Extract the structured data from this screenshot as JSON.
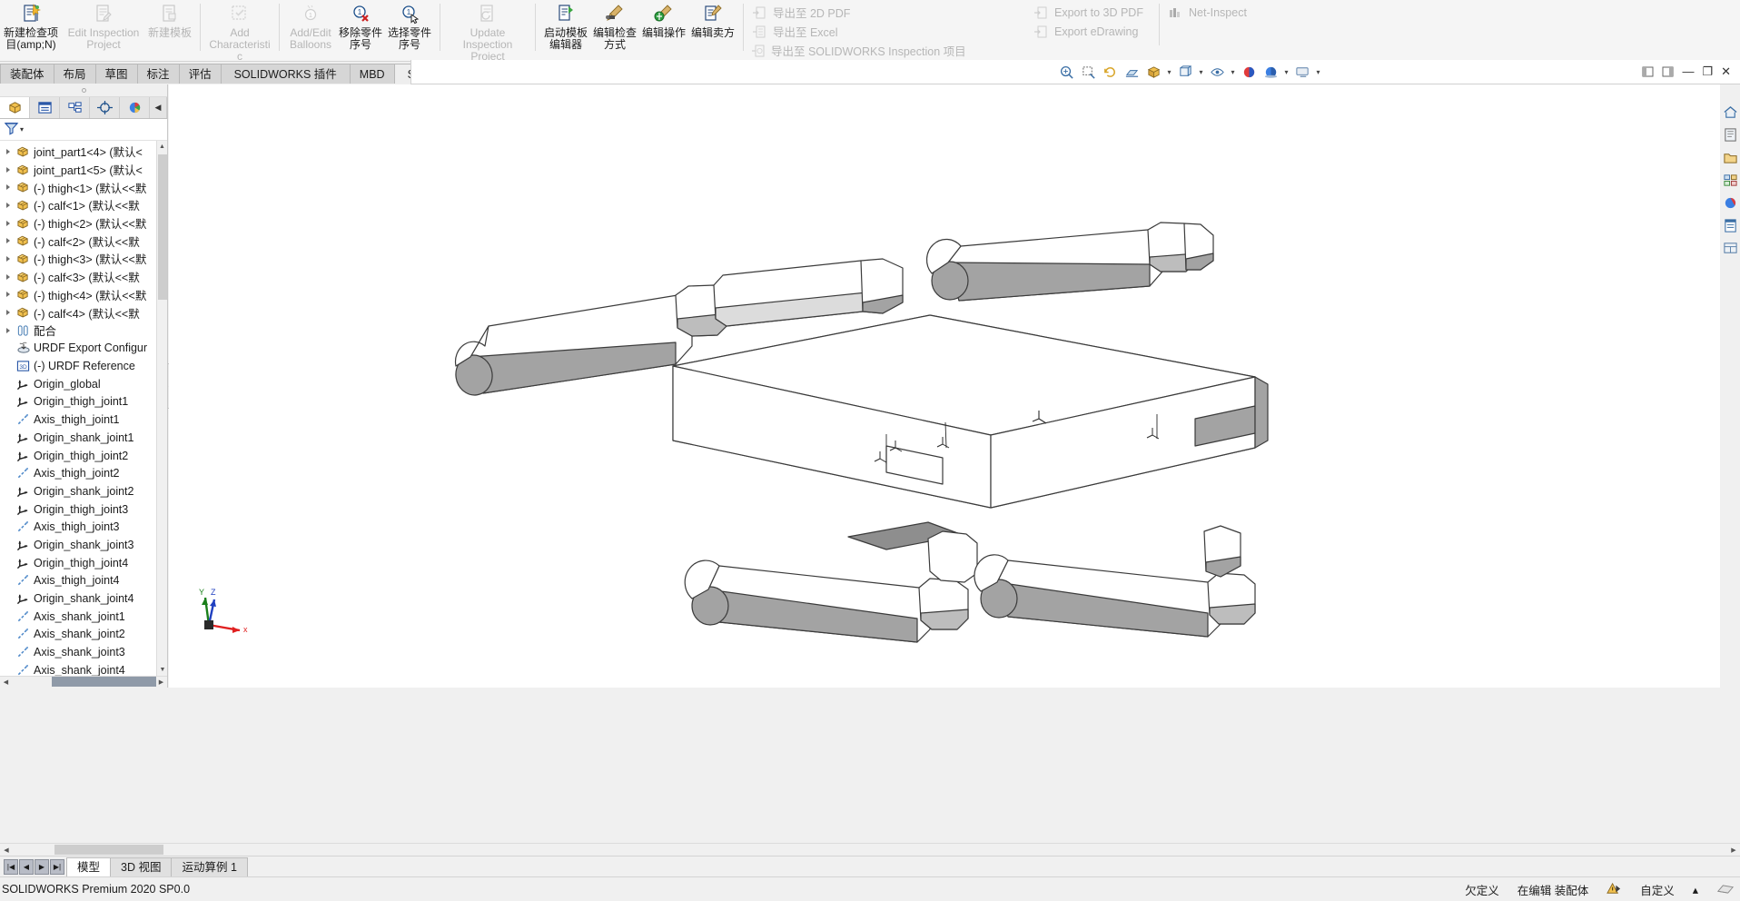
{
  "app": {
    "product": "SOLIDWORKS Premium 2020 SP0.0"
  },
  "ribbon": {
    "groups": [
      {
        "buttons": [
          {
            "name": "new-inspection-item",
            "label": "新建检查项目(amp;N)",
            "icon": "new-inspection-icon",
            "enabled": true
          },
          {
            "name": "edit-inspection-project",
            "label": "Edit Inspection Project",
            "icon": "edit-inspection-icon",
            "enabled": false
          },
          {
            "name": "new-template",
            "label": "新建模板",
            "icon": "new-template-icon",
            "enabled": false
          }
        ]
      },
      {
        "buttons": [
          {
            "name": "add-characteristic",
            "label": "Add Characteristic",
            "icon": "add-characteristic-icon",
            "enabled": false
          }
        ]
      },
      {
        "buttons": [
          {
            "name": "add-edit-balloons",
            "label": "Add/Edit Balloons",
            "icon": "balloon-icon",
            "enabled": false
          },
          {
            "name": "remove-balloon",
            "label": "移除零件序号",
            "icon": "remove-balloon-icon",
            "enabled": true
          },
          {
            "name": "select-balloon",
            "label": "选择零件序号",
            "icon": "select-balloon-icon",
            "enabled": true
          }
        ]
      },
      {
        "buttons": [
          {
            "name": "update-inspection-project",
            "label": "Update Inspection Project",
            "icon": "update-inspection-icon",
            "enabled": false
          }
        ]
      },
      {
        "buttons": [
          {
            "name": "launch-template-editor",
            "label": "启动模板编辑器",
            "icon": "template-editor-icon",
            "enabled": true
          },
          {
            "name": "edit-inspection-method",
            "label": "编辑检查方式",
            "icon": "edit-method-icon",
            "enabled": true
          },
          {
            "name": "edit-operation",
            "label": "编辑操作",
            "icon": "edit-operation-icon",
            "enabled": true
          },
          {
            "name": "edit-vendor",
            "label": "编辑卖方",
            "icon": "edit-vendor-icon",
            "enabled": true
          }
        ]
      }
    ],
    "export_list_1": [
      {
        "name": "export-2d-pdf",
        "label": "导出至 2D PDF",
        "icon": "export-icon"
      },
      {
        "name": "export-excel",
        "label": "导出至 Excel",
        "icon": "export-excel-icon"
      },
      {
        "name": "export-sw-inspection",
        "label": "导出至 SOLIDWORKS Inspection 项目",
        "icon": "export-sw-icon"
      }
    ],
    "export_list_2": [
      {
        "name": "export-3d-pdf",
        "label": "Export to 3D PDF",
        "icon": "export-icon"
      },
      {
        "name": "export-edrawing",
        "label": "Export eDrawing",
        "icon": "export-icon"
      }
    ],
    "net_inspect": [
      {
        "name": "net-inspect",
        "label": "Net-Inspect",
        "icon": "net-inspect-icon"
      }
    ]
  },
  "tabs": [
    {
      "name": "tab-assembly",
      "label": "装配体",
      "active": false
    },
    {
      "name": "tab-layout",
      "label": "布局",
      "active": false
    },
    {
      "name": "tab-sketch",
      "label": "草图",
      "active": false
    },
    {
      "name": "tab-annotation",
      "label": "标注",
      "active": false
    },
    {
      "name": "tab-evaluate",
      "label": "评估",
      "active": false
    },
    {
      "name": "tab-sw-addins",
      "label": "SOLIDWORKS 插件",
      "active": false
    },
    {
      "name": "tab-mbd",
      "label": "MBD",
      "active": false
    },
    {
      "name": "tab-sw-inspection",
      "label": "SOLIDWORKS Inspection",
      "active": true
    }
  ],
  "panel": {
    "tabs": [
      {
        "name": "feature-manager-tab",
        "icon": "feature-tree-icon",
        "active": true
      },
      {
        "name": "property-manager-tab",
        "icon": "property-manager-icon",
        "active": false
      },
      {
        "name": "configuration-manager-tab",
        "icon": "configuration-icon",
        "active": false
      },
      {
        "name": "dimxpert-manager-tab",
        "icon": "dimxpert-icon",
        "active": false
      },
      {
        "name": "display-manager-tab",
        "icon": "display-manager-icon",
        "active": false
      },
      {
        "name": "panel-tabs-more",
        "icon": "chevron-right-icon",
        "active": false
      }
    ],
    "filter_placeholder": ""
  },
  "tree": [
    {
      "name": "joint_part1-4",
      "label": "joint_part1<4> (默认<",
      "icon": "part-icon",
      "expandable": true
    },
    {
      "name": "joint_part1-5",
      "label": "joint_part1<5> (默认<",
      "icon": "part-icon",
      "expandable": true
    },
    {
      "name": "thigh-1",
      "label": "(-) thigh<1> (默认<<默",
      "icon": "part-icon",
      "expandable": true
    },
    {
      "name": "calf-1",
      "label": "(-) calf<1> (默认<<默",
      "icon": "part-icon",
      "expandable": true
    },
    {
      "name": "thigh-2",
      "label": "(-) thigh<2> (默认<<默",
      "icon": "part-icon",
      "expandable": true
    },
    {
      "name": "calf-2",
      "label": "(-) calf<2> (默认<<默",
      "icon": "part-icon",
      "expandable": true
    },
    {
      "name": "thigh-3",
      "label": "(-) thigh<3> (默认<<默",
      "icon": "part-icon",
      "expandable": true
    },
    {
      "name": "calf-3",
      "label": "(-) calf<3> (默认<<默",
      "icon": "part-icon",
      "expandable": true
    },
    {
      "name": "thigh-4",
      "label": "(-) thigh<4> (默认<<默",
      "icon": "part-icon",
      "expandable": true
    },
    {
      "name": "calf-4",
      "label": "(-) calf<4> (默认<<默",
      "icon": "part-icon",
      "expandable": true
    },
    {
      "name": "mates",
      "label": "配合",
      "icon": "mates-icon",
      "expandable": true
    },
    {
      "name": "urdf-export-configuration",
      "label": "URDF Export Configur",
      "icon": "urdf-config-icon",
      "expandable": false
    },
    {
      "name": "urdf-reference",
      "label": "(-) URDF Reference",
      "icon": "3d-reference-icon",
      "expandable": false
    },
    {
      "name": "origin-global",
      "label": "Origin_global",
      "icon": "coordinate-system-icon",
      "expandable": false
    },
    {
      "name": "origin-thigh-joint1",
      "label": "Origin_thigh_joint1",
      "icon": "coordinate-system-icon",
      "expandable": false
    },
    {
      "name": "axis-thigh-joint1",
      "label": "Axis_thigh_joint1",
      "icon": "axis-icon",
      "expandable": false
    },
    {
      "name": "origin-shank-joint1",
      "label": "Origin_shank_joint1",
      "icon": "coordinate-system-icon",
      "expandable": false
    },
    {
      "name": "origin-thigh-joint2",
      "label": "Origin_thigh_joint2",
      "icon": "coordinate-system-icon",
      "expandable": false
    },
    {
      "name": "axis-thigh-joint2",
      "label": "Axis_thigh_joint2",
      "icon": "axis-icon",
      "expandable": false
    },
    {
      "name": "origin-shank-joint2",
      "label": "Origin_shank_joint2",
      "icon": "coordinate-system-icon",
      "expandable": false
    },
    {
      "name": "origin-thigh-joint3",
      "label": "Origin_thigh_joint3",
      "icon": "coordinate-system-icon",
      "expandable": false
    },
    {
      "name": "axis-thigh-joint3",
      "label": "Axis_thigh_joint3",
      "icon": "axis-icon",
      "expandable": false
    },
    {
      "name": "origin-shank-joint3",
      "label": "Origin_shank_joint3",
      "icon": "coordinate-system-icon",
      "expandable": false
    },
    {
      "name": "origin-thigh-joint4",
      "label": "Origin_thigh_joint4",
      "icon": "coordinate-system-icon",
      "expandable": false
    },
    {
      "name": "axis-thigh-joint4",
      "label": "Axis_thigh_joint4",
      "icon": "axis-icon",
      "expandable": false
    },
    {
      "name": "origin-shank-joint4",
      "label": "Origin_shank_joint4",
      "icon": "coordinate-system-icon",
      "expandable": false
    },
    {
      "name": "axis-shank-joint1",
      "label": "Axis_shank_joint1",
      "icon": "axis-icon",
      "expandable": false
    },
    {
      "name": "axis-shank-joint2",
      "label": "Axis_shank_joint2",
      "icon": "axis-icon",
      "expandable": false
    },
    {
      "name": "axis-shank-joint3",
      "label": "Axis_shank_joint3",
      "icon": "axis-icon",
      "expandable": false
    },
    {
      "name": "axis-shank-joint4",
      "label": "Axis_shank_joint4",
      "icon": "axis-icon",
      "expandable": false
    }
  ],
  "viewbar": [
    {
      "name": "zoom-to-fit-button",
      "icon": "zoom-fit-icon"
    },
    {
      "name": "zoom-to-area-button",
      "icon": "zoom-area-icon"
    },
    {
      "name": "previous-view-button",
      "icon": "previous-view-icon"
    },
    {
      "name": "section-view-button",
      "icon": "section-view-icon"
    },
    {
      "name": "view-orientation-button",
      "icon": "view-orientation-icon"
    },
    {
      "name": "display-style-button",
      "icon": "display-style-icon"
    },
    {
      "name": "hide-show-items-button",
      "icon": "hide-show-icon"
    },
    {
      "name": "edit-appearance-button",
      "icon": "appearance-icon"
    },
    {
      "name": "apply-scene-button",
      "icon": "scene-icon"
    },
    {
      "name": "view-settings-button",
      "icon": "view-settings-icon"
    }
  ],
  "rightstrip": [
    {
      "name": "home-icon"
    },
    {
      "name": "appearances-icon"
    },
    {
      "name": "file-explorer-icon"
    },
    {
      "name": "view-palette-icon"
    },
    {
      "name": "appearances-scenes-icon"
    },
    {
      "name": "custom-properties-icon"
    },
    {
      "name": "design-library-icon"
    }
  ],
  "splitter": {
    "name": "panel-splitter",
    "glyph": "◀"
  },
  "document_tabs": {
    "nav": [
      {
        "name": "first-tab-button",
        "glyph": "|◀"
      },
      {
        "name": "prev-tab-button",
        "glyph": "◀"
      },
      {
        "name": "next-tab-button",
        "glyph": "▶"
      },
      {
        "name": "last-tab-button",
        "glyph": "▶|"
      }
    ],
    "tabs": [
      {
        "name": "doc-tab-model",
        "label": "模型",
        "active": true
      },
      {
        "name": "doc-tab-3dview",
        "label": "3D 视图",
        "active": false
      },
      {
        "name": "doc-tab-motion-study",
        "label": "运动算例 1",
        "active": false
      }
    ]
  },
  "status": {
    "left": "SOLIDWORKS Premium 2020 SP0.0",
    "under_defined": "欠定义",
    "editing": "在编辑 装配体",
    "custom": "自定义",
    "caret": "▴"
  }
}
